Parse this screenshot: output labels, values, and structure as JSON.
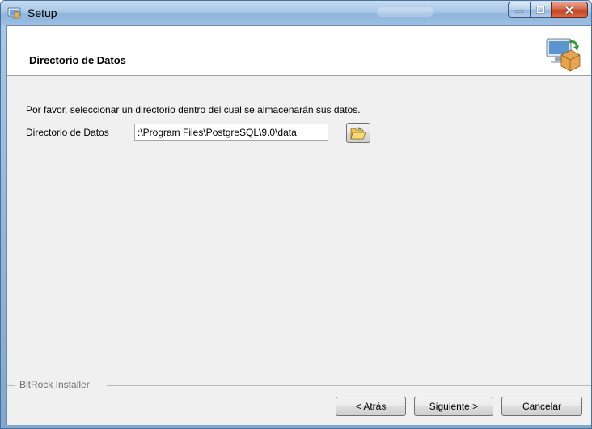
{
  "window": {
    "title": "Setup",
    "app_icon": "setup-icon",
    "caption_buttons": [
      "minimize-icon",
      "maximize-icon",
      "close-icon"
    ]
  },
  "header": {
    "title": "Directorio de Datos",
    "icon": "installer-computer-box-icon"
  },
  "body": {
    "description": "Por favor, seleccionar un directorio dentro del cual se almacenarán sus datos.",
    "data_dir_label": "Directorio de Datos",
    "data_dir_value": ":\\Program Files\\PostgreSQL\\9.0\\data",
    "browse_icon": "folder-open-icon"
  },
  "footer": {
    "group_label": "BitRock Installer",
    "back_label": "< Atrás",
    "next_label": "Siguiente >",
    "cancel_label": "Cancelar"
  },
  "colors": {
    "title_bar": "#a8c7e6",
    "content_background": "#f0f0f0",
    "close_button": "#c2431f"
  }
}
